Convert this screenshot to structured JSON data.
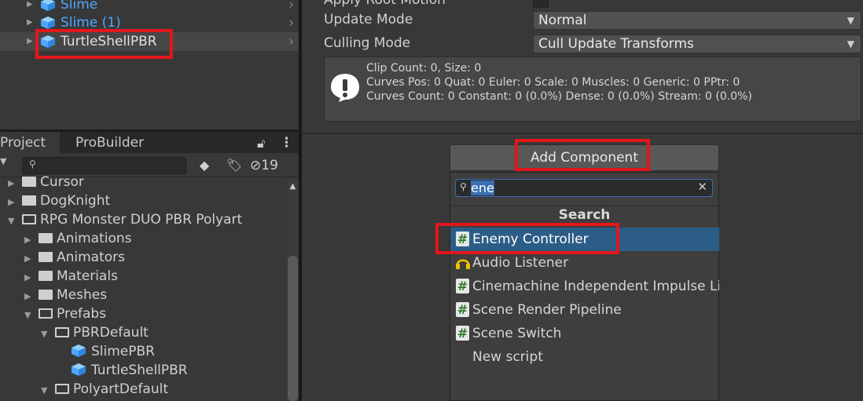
{
  "hierarchy": {
    "items": [
      {
        "label": "Slime",
        "color": "#4fa6ff"
      },
      {
        "label": "Slime (1)",
        "color": "#4fa6ff"
      },
      {
        "label": "TurtleShellPBR",
        "color": "#d8d8d8"
      }
    ]
  },
  "project_panel": {
    "tabs": [
      "Project",
      "ProBuilder"
    ],
    "hidden_count": "19",
    "search_placeholder": "",
    "tree": [
      {
        "label": "Cursor"
      },
      {
        "label": "DogKnight"
      },
      {
        "label": "RPG Monster DUO PBR Polyart"
      },
      {
        "label": "Animations"
      },
      {
        "label": "Animators"
      },
      {
        "label": "Materials"
      },
      {
        "label": "Meshes"
      },
      {
        "label": "Prefabs"
      },
      {
        "label": "PBRDefault"
      },
      {
        "label": "SlimePBR"
      },
      {
        "label": "TurtleShellPBR"
      },
      {
        "label": "PolyartDefault"
      }
    ]
  },
  "inspector": {
    "partial_top_label": "Apply Root Motion",
    "update_mode_label": "Update Mode",
    "update_mode_value": "Normal",
    "culling_mode_label": "Culling Mode",
    "culling_mode_value": "Cull Update Transforms",
    "info_lines": [
      "Clip Count: 0, Size: 0",
      "Curves Pos: 0 Quat: 0 Euler: 0 Scale: 0 Muscles: 0 Generic: 0 PPtr: 0",
      "Curves Count: 0 Constant: 0 (0.0%) Dense: 0 (0.0%) Stream: 0 (0.0%)"
    ],
    "add_component_label": "Add Component"
  },
  "component_popup": {
    "search_value": "ene",
    "header": "Search",
    "results": [
      {
        "label": "Enemy Controller",
        "icon": "script-icon",
        "selected": true
      },
      {
        "label": "Audio Listener",
        "icon": "headphones-icon",
        "selected": false
      },
      {
        "label": "Cinemachine Independent Impulse Listener",
        "icon": "script-icon",
        "selected": false
      },
      {
        "label": "Scene Render Pipeline",
        "icon": "script-icon",
        "selected": false
      },
      {
        "label": "Scene Switch",
        "icon": "script-icon",
        "selected": false
      },
      {
        "label": "New script",
        "icon": "",
        "selected": false
      }
    ]
  },
  "colors": {
    "highlight_box": "#e3161b",
    "selection": "#2c5d87",
    "prefab_blue": "#4fa6ff"
  }
}
